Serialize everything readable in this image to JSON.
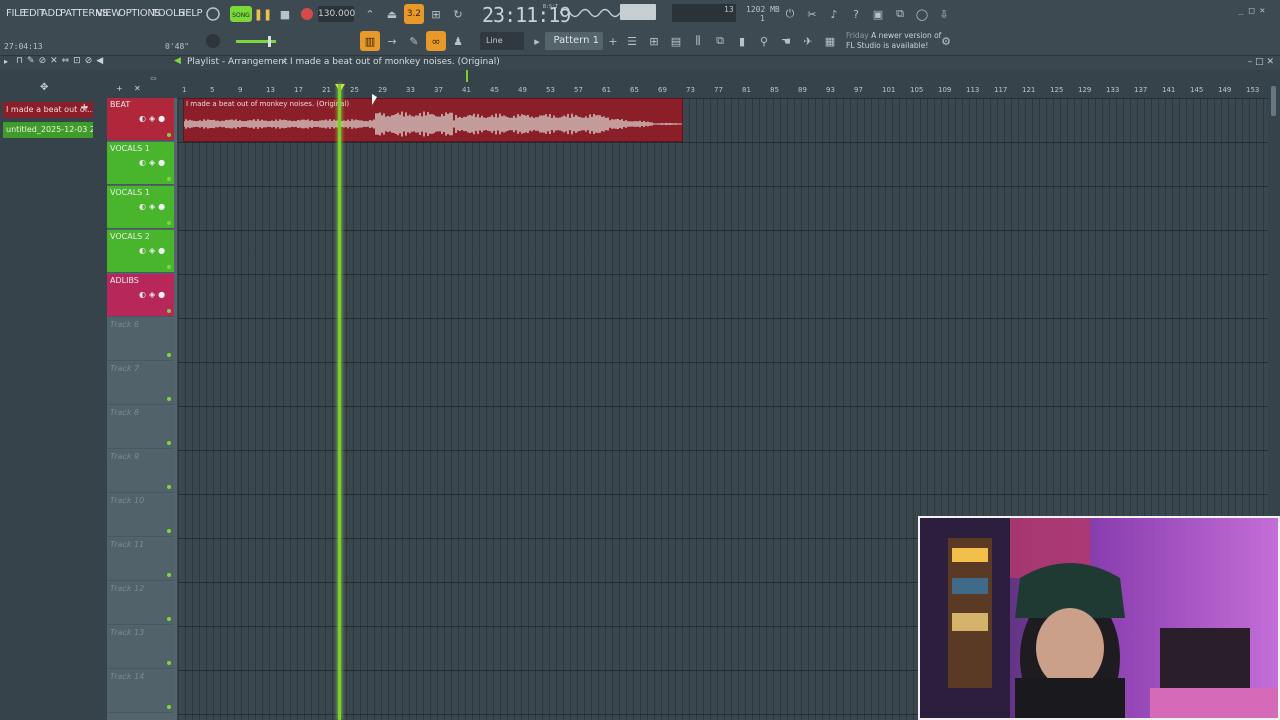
{
  "menu": [
    "FILE",
    "EDIT",
    "ADD",
    "PATTERNS",
    "VIEW",
    "OPTIONS",
    "TOOLS",
    "HELP"
  ],
  "transport": {
    "song_label": "SONG",
    "tempo": "130.000",
    "clock": "23:11:19",
    "clock_sub": "B:S:T",
    "cpu": "13",
    "memory": "1202 MB",
    "polyphony": "1",
    "time_left": "27:04:13",
    "time_right": "0'48\""
  },
  "toolbar": {
    "snap": "Line",
    "pattern": "Pattern 1"
  },
  "news": {
    "day": "Friday",
    "line1": "A newer version of",
    "line2": "FL Studio is available!"
  },
  "playlist": {
    "title": "Playlist - Arrangement",
    "separator": "›",
    "clip_name": "I made a beat out of monkey noises. (Original)"
  },
  "browser": {
    "items": [
      "I made a beat out of...",
      "untitled_2025-12-03 20-..."
    ]
  },
  "tracks": [
    {
      "name": "BEAT",
      "color": "#b0263a"
    },
    {
      "name": "VOCALS 1",
      "color": "#49b52c"
    },
    {
      "name": "VOCALS 1",
      "color": "#49b52c"
    },
    {
      "name": "VOCALS 2",
      "color": "#49b52c"
    },
    {
      "name": "ADLIBS",
      "color": "#b8275a"
    },
    {
      "name": "Track 6",
      "color": ""
    },
    {
      "name": "Track 7",
      "color": ""
    },
    {
      "name": "Track 8",
      "color": ""
    },
    {
      "name": "Track 9",
      "color": ""
    },
    {
      "name": "Track 10",
      "color": ""
    },
    {
      "name": "Track 11",
      "color": ""
    },
    {
      "name": "Track 12",
      "color": ""
    },
    {
      "name": "Track 13",
      "color": ""
    },
    {
      "name": "Track 14",
      "color": ""
    }
  ],
  "ruler": [
    "1",
    "5",
    "9",
    "13",
    "17",
    "21",
    "25",
    "29",
    "33",
    "37",
    "41",
    "45",
    "49",
    "53",
    "57",
    "61",
    "65",
    "69",
    "73",
    "77",
    "81",
    "85",
    "89",
    "93",
    "97",
    "101",
    "105",
    "109",
    "113",
    "117",
    "121",
    "125",
    "129",
    "133",
    "137",
    "141",
    "145",
    "149",
    "153"
  ],
  "colors": {
    "accent_green": "#7ccf2b",
    "beat_clip": "#8a1f2a",
    "orange_active": "#e79a2a"
  }
}
